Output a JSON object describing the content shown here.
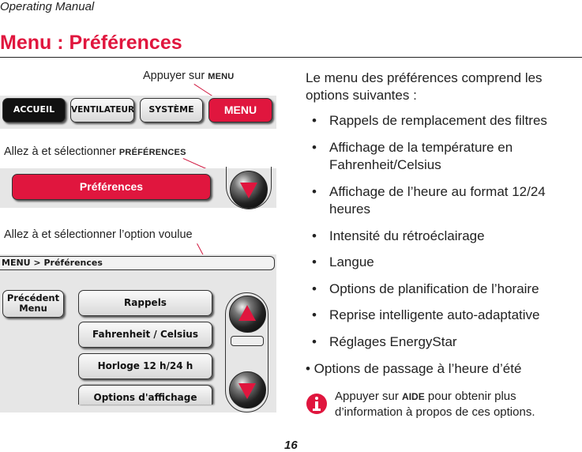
{
  "header": {
    "label": "Operating Manual"
  },
  "title": "Menu : Préférences",
  "step1": {
    "caption_prefix": "Appuyer sur ",
    "caption_key": "MENU"
  },
  "tabs": [
    {
      "label": "ACCUEIL"
    },
    {
      "label": "VENTILATEUR"
    },
    {
      "label": "SYSTÈME"
    },
    {
      "label": "MENU"
    }
  ],
  "step2": {
    "caption_prefix": "Allez à et sélectionner ",
    "caption_key": "PRÉFÉRENCES",
    "button_label": "Préférences"
  },
  "step3": {
    "caption": "Allez à et sélectionner l’option voulue"
  },
  "screen": {
    "breadcrumb": "MENU > Préférences",
    "back_button": {
      "line1": "Précédent",
      "line2": "Menu"
    },
    "options": [
      "Rappels",
      "Fahrenheit / Celsius",
      "Horloge 12 h/24 h",
      "Options d'affichage"
    ]
  },
  "description": {
    "intro_line1": "Le menu des préférences comprend les",
    "intro_line2": "options suivantes :",
    "items": [
      {
        "bullet": "•",
        "line1": "Rappels de remplacement des filtres"
      },
      {
        "bullet": "•",
        "line1": "Affichage de la température en",
        "line2": "Fahrenheit/Celsius"
      },
      {
        "bullet": "•",
        "line1": "Affichage de l’heure au format 12/24",
        "line2": "heures"
      },
      {
        "bullet": "•",
        "line1": "Intensité du rétroéclairage"
      },
      {
        "bullet": "•",
        "line1": "Langue"
      },
      {
        "bullet": "•",
        "line1": "Options de planification de l’horaire"
      },
      {
        "bullet": "•",
        "line1": "Reprise intelligente auto-adaptative"
      },
      {
        "bullet": "•",
        "line1": "Réglages EnergyStar"
      }
    ],
    "last_item": "• Options de passage à l’heure d’été"
  },
  "note": {
    "icon": "info-icon",
    "prefix": "Appuyer sur ",
    "key": "AIDE",
    "suffix": " pour obtenir plus",
    "line2": "d’information à propos de ces options."
  },
  "page_number": "16",
  "colors": {
    "accent": "#e0163e"
  }
}
